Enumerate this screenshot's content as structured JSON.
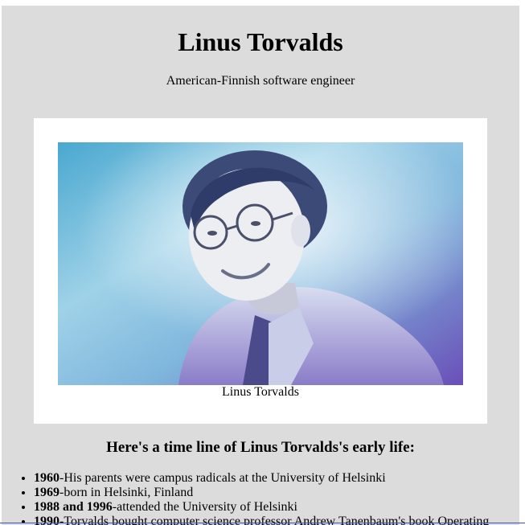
{
  "page": {
    "title": "Linus Torvalds",
    "subtitle": "American-Finnish software engineer"
  },
  "figure": {
    "image_icon": "portrait-photo",
    "caption": "Linus Torvalds"
  },
  "timeline": {
    "heading": "Here's a time line of Linus Torvalds's early life:",
    "items": [
      {
        "year": "1960",
        "text": "-His parents were campus radicals at the University of Helsinki"
      },
      {
        "year": "1969",
        "text": "-born in Helsinki, Finland"
      },
      {
        "year": "1988 and 1996",
        "text": "-attended the University of Helsinki"
      },
      {
        "year": "1990",
        "text": "-Torvalds bought computer science professor Andrew Tanenbaum's book Operating"
      }
    ]
  },
  "colors": {
    "page_background": "#dcdcdc",
    "figure_background": "#ffffff",
    "bottom_rule": "#3f51b5"
  }
}
